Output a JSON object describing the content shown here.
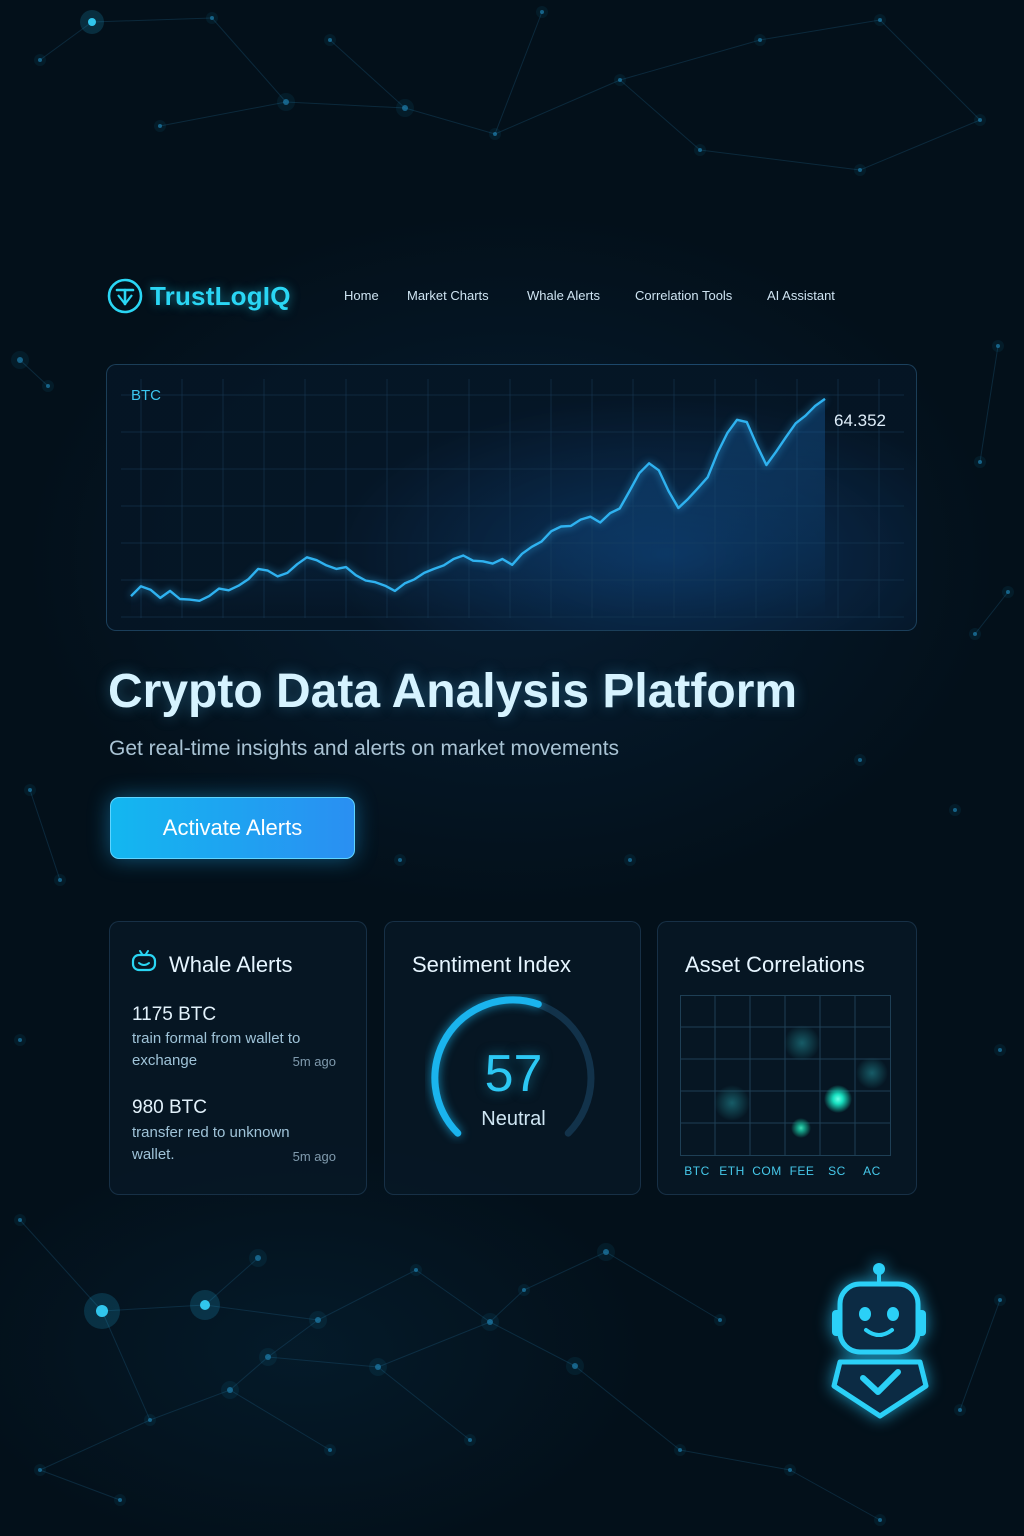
{
  "brand": {
    "name": "TrustLogIQ",
    "logo_icon": "shield-check-icon",
    "accent": "#2ad6f4"
  },
  "nav": {
    "items": [
      {
        "label": "Home"
      },
      {
        "label": "Market Charts"
      },
      {
        "label": "Whale Alerts"
      },
      {
        "label": "Correlation Tools"
      },
      {
        "label": "AI Assistant"
      }
    ]
  },
  "chart_data": {
    "type": "line",
    "series": [
      {
        "name": "BTC",
        "values": [
          28.6,
          30.3,
          29.7,
          28.3,
          29.5,
          28.1,
          28.0,
          27.8,
          28.6,
          29.9,
          29.6,
          30.4,
          31.5,
          33.3,
          33.0,
          32.0,
          32.6,
          34.1,
          35.3,
          34.8,
          33.9,
          33.3,
          33.6,
          32.2,
          31.3,
          31.0,
          30.4,
          29.5,
          30.8,
          31.5,
          32.6,
          33.3,
          33.9,
          35.0,
          35.6,
          34.7,
          34.6,
          34.2,
          35.0,
          34.0,
          35.9,
          37.1,
          38.0,
          39.8,
          40.6,
          40.7,
          41.8,
          42.3,
          41.3,
          42.9,
          43.7,
          46.7,
          49.8,
          51.5,
          50.3,
          46.7,
          43.8,
          45.4,
          47.2,
          49.1,
          53.3,
          56.7,
          59.0,
          58.6,
          54.7,
          51.2,
          53.5,
          56.0,
          58.4,
          59.7,
          61.4,
          62.6
        ],
        "last_label": "64.352"
      }
    ],
    "ylim": [
      25,
      65
    ],
    "grid": true
  },
  "hero": {
    "title": "Crypto Data Analysis Platform",
    "subtitle": "Get real-time insights and alerts on market movements",
    "cta_label": "Activate Alerts"
  },
  "cards": {
    "whale": {
      "title": "Whale Alerts",
      "icon": "whale-icon",
      "alerts": [
        {
          "amount": "1175 BTC",
          "desc": "train formal from wallet to exchange",
          "time": "5m ago"
        },
        {
          "amount": "980 BTC",
          "desc": "transfer red to unknown wallet.",
          "time": "5m ago"
        }
      ]
    },
    "sentiment": {
      "title": "Sentiment Index",
      "value": 57,
      "label": "Neutral"
    },
    "correlations": {
      "title": "Asset Correlations",
      "labels": [
        "BTC",
        "ETH",
        "COM",
        "FEE",
        "SC",
        "AC"
      ]
    }
  },
  "assistant": {
    "icon": "robot-assistant-icon"
  },
  "colors": {
    "background": "#03101a",
    "line": "#2fb2f0",
    "cta_start": "#13b7f0",
    "cta_end": "#2a8ff2"
  }
}
